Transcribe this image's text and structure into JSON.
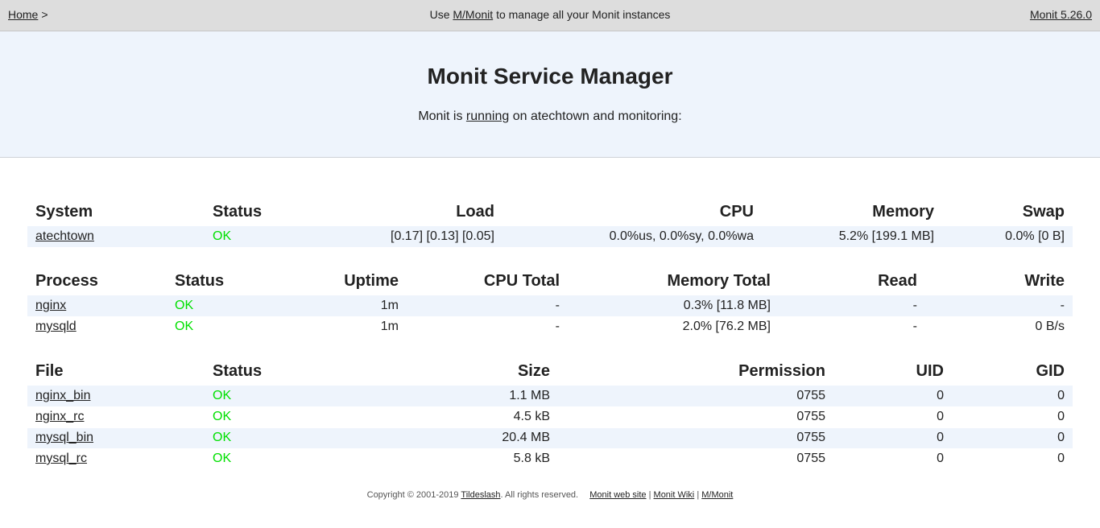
{
  "topnav": {
    "home_label": "Home",
    "crumb_sep": ">",
    "center_prefix": "Use",
    "center_link": "M/Monit",
    "center_suffix": "to manage all your Monit instances",
    "version_link": "Monit 5.26.0"
  },
  "header": {
    "title": "Monit Service Manager",
    "sub_prefix": "Monit is",
    "sub_link": "running",
    "sub_suffix": "on atechtown and monitoring:"
  },
  "system": {
    "headers": [
      "System",
      "Status",
      "Load",
      "CPU",
      "Memory",
      "Swap"
    ],
    "rows": [
      {
        "name": "atechtown",
        "status": "OK",
        "load": "[0.17] [0.13] [0.05]",
        "cpu": "0.0%us, 0.0%sy, 0.0%wa",
        "memory": "5.2% [199.1 MB]",
        "swap": "0.0% [0 B]"
      }
    ]
  },
  "process": {
    "headers": [
      "Process",
      "Status",
      "Uptime",
      "CPU Total",
      "Memory Total",
      "Read",
      "Write"
    ],
    "rows": [
      {
        "name": "nginx",
        "status": "OK",
        "uptime": "1m",
        "cpu_total": "-",
        "memory_total": "0.3% [11.8 MB]",
        "read": "-",
        "write": "-"
      },
      {
        "name": "mysqld",
        "status": "OK",
        "uptime": "1m",
        "cpu_total": "-",
        "memory_total": "2.0% [76.2 MB]",
        "read": "-",
        "write": "0 B/s"
      }
    ]
  },
  "file": {
    "headers": [
      "File",
      "Status",
      "Size",
      "Permission",
      "UID",
      "GID"
    ],
    "rows": [
      {
        "name": "nginx_bin",
        "status": "OK",
        "size": "1.1 MB",
        "permission": "0755",
        "uid": "0",
        "gid": "0"
      },
      {
        "name": "nginx_rc",
        "status": "OK",
        "size": "4.5 kB",
        "permission": "0755",
        "uid": "0",
        "gid": "0"
      },
      {
        "name": "mysql_bin",
        "status": "OK",
        "size": "20.4 MB",
        "permission": "0755",
        "uid": "0",
        "gid": "0"
      },
      {
        "name": "mysql_rc",
        "status": "OK",
        "size": "5.8 kB",
        "permission": "0755",
        "uid": "0",
        "gid": "0"
      }
    ]
  },
  "footer": {
    "copyright": "Copyright © 2001-2019",
    "company_link": "Tildeslash",
    "rights": ". All rights reserved.",
    "links": [
      "Monit web site",
      "Monit Wiki",
      "M/Monit"
    ],
    "link_sep": "|"
  },
  "colors": {
    "ok": "#00e000",
    "stripe": "#eef4fc",
    "topbar": "#dddddd"
  }
}
